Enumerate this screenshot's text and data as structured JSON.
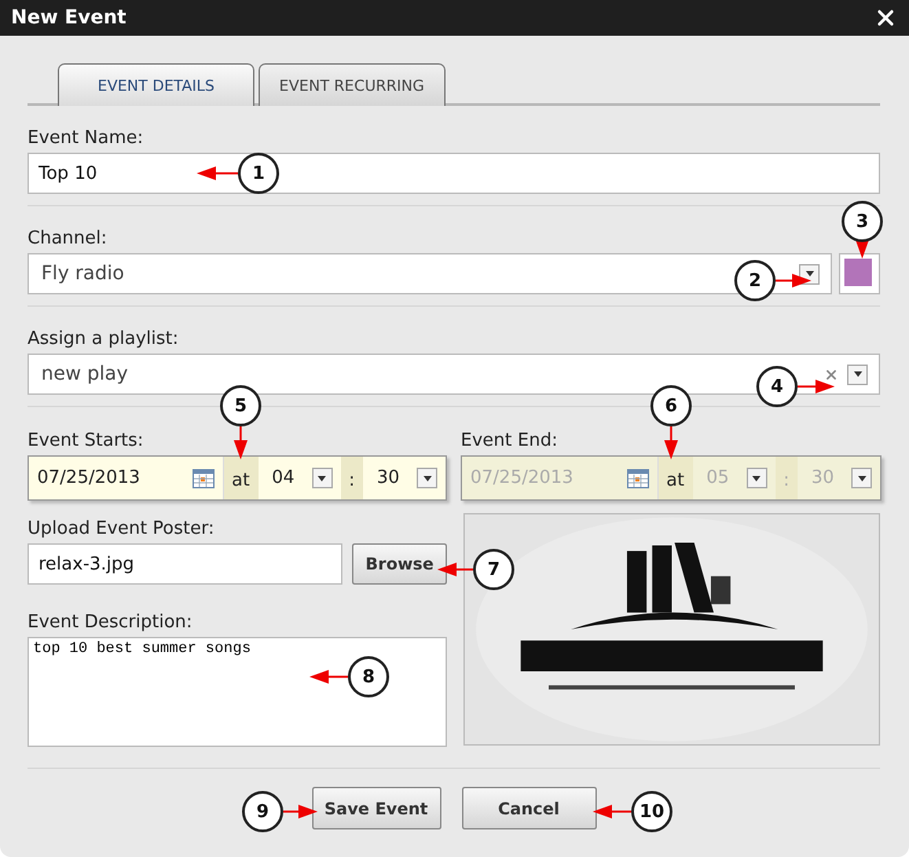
{
  "window": {
    "title": "New Event"
  },
  "tabs": [
    {
      "label": "EVENT DETAILS",
      "selected": true
    },
    {
      "label": "EVENT RECURRING",
      "selected": false
    }
  ],
  "event_name": {
    "label": "Event Name:",
    "value": "Top 10"
  },
  "channel": {
    "label": "Channel:",
    "value": "Fly radio",
    "color": "#b274b9"
  },
  "playlist": {
    "label": "Assign a playlist:",
    "value": "new play"
  },
  "schedule": [
    {
      "label": "Event Starts:",
      "date": "07/25/2013",
      "at": "at",
      "hour": "04",
      "separator": ":",
      "minute": "30",
      "disabled": false
    },
    {
      "label": "Event End:",
      "date": "07/25/2013",
      "at": "at",
      "hour": "05",
      "separator": ":",
      "minute": "30",
      "disabled": true
    }
  ],
  "poster": {
    "label": "Upload Event Poster:",
    "value": "relax-3.jpg",
    "button": "Browse"
  },
  "description": {
    "label": "Event Description:",
    "value": "top 10 best summer songs"
  },
  "buttons": [
    "Save Event",
    "Cancel"
  ],
  "callouts": [
    "1",
    "2",
    "3",
    "4",
    "5",
    "6",
    "7",
    "8",
    "9",
    "10"
  ]
}
